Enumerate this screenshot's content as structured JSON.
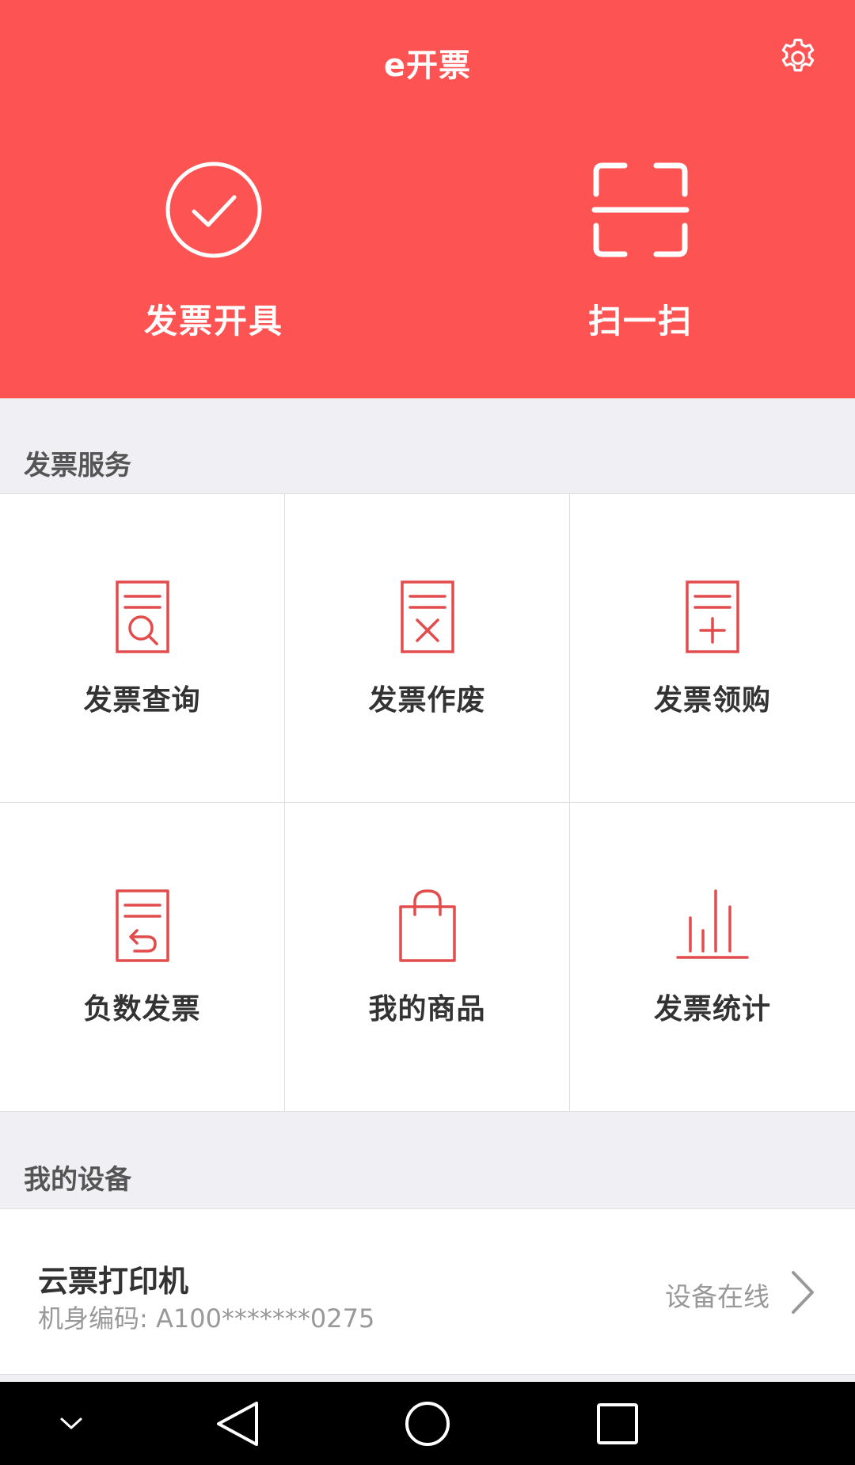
{
  "header": {
    "title": "e开票",
    "settings_icon": "gear-icon",
    "actions": [
      {
        "label": "发票开具",
        "icon": "check-circle-icon"
      },
      {
        "label": "扫一扫",
        "icon": "scan-icon"
      }
    ]
  },
  "invoice_services": {
    "title": "发票服务",
    "items": [
      {
        "label": "发票查询",
        "icon": "invoice-search-icon"
      },
      {
        "label": "发票作废",
        "icon": "invoice-void-icon"
      },
      {
        "label": "发票领购",
        "icon": "invoice-purchase-icon"
      },
      {
        "label": "负数发票",
        "icon": "invoice-negative-icon"
      },
      {
        "label": "我的商品",
        "icon": "shopping-bag-icon"
      },
      {
        "label": "发票统计",
        "icon": "bar-chart-icon"
      }
    ]
  },
  "devices": {
    "title": "我的设备",
    "items": [
      {
        "name": "云票打印机",
        "code": "机身编码: A100*******0275",
        "status": "设备在线"
      }
    ]
  },
  "colors": {
    "brand": "#fd5353",
    "icon": "#e24c4c",
    "background": "#efeff4"
  },
  "navbar": {
    "buttons": [
      "chevron-down-icon",
      "back-icon",
      "home-icon",
      "recents-icon"
    ]
  }
}
